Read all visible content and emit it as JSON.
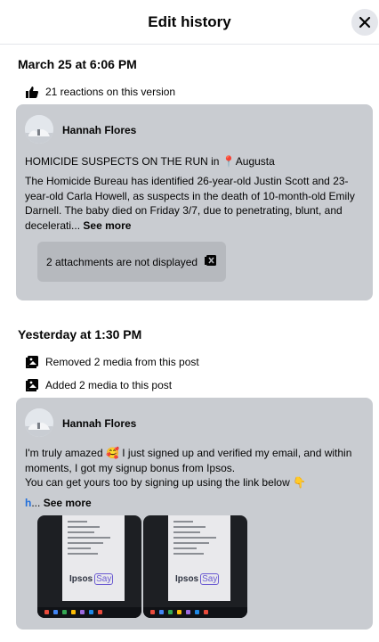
{
  "header": {
    "title": "Edit history"
  },
  "sections": [
    {
      "date": "March 25 at 6:06 PM",
      "events": [
        {
          "text": "21 reactions on this version",
          "icon": "thumbs-up-icon"
        }
      ],
      "post": {
        "author": "Hannah Flores",
        "headline_prefix": "HOMICIDE SUSPECTS ON THE RUN in",
        "headline_pin": "📍",
        "headline_place": "Augusta",
        "body": "The Homicide Bureau has identified 26-year-old Justin Scott and 23-year-old Carla Howell, as suspects in the death of 10-month-old Emily Darnell. The baby died on Friday 3/7, due to penetrating, blunt, and decelerati...",
        "see_more": "See more",
        "attachments_note": "2 attachments are not displayed"
      }
    },
    {
      "date": "Yesterday at 1:30 PM",
      "events": [
        {
          "text": "Removed 2 media from this post",
          "icon": "media-icon"
        },
        {
          "text": "Added 2 media to this post",
          "icon": "media-icon"
        }
      ],
      "post": {
        "author": "Hannah Flores",
        "body_line1": "I'm truly amazed 🥰 I just signed up and verified my email, and within moments, I got my signup bonus from Ipsos.",
        "body_line2": "You can get yours too by signing up using the link below 👇",
        "link_stub": "h",
        "ellipsis": "...",
        "see_more": "See more",
        "media": [
          {
            "logo": "Ipsos",
            "badge": "Say"
          },
          {
            "logo": "Ipsos",
            "badge": "Say"
          }
        ]
      }
    }
  ],
  "colors": {
    "card_bg": "#c9ccd1",
    "link": "#216fdb",
    "header_border": "#e4e6eb"
  }
}
